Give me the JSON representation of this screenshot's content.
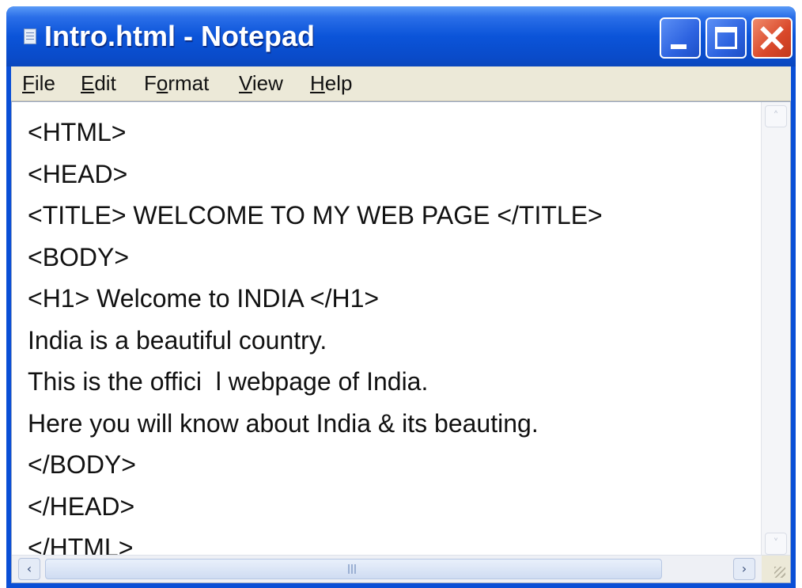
{
  "window": {
    "title": "Intro.html - Notepad",
    "icons": {
      "app": "notepad-icon",
      "minimize": "minimize-icon",
      "maximize": "maximize-icon",
      "close": "close-icon"
    }
  },
  "menu": {
    "file": "File",
    "edit": "Edit",
    "format_prefix": "F",
    "format_u": "o",
    "format_suffix": "rmat",
    "view": "View",
    "help": "Help"
  },
  "editor": {
    "lines": [
      "<HTML>",
      "<HEAD>",
      "<TITLE> WELCOME TO MY WEB PAGE </TITLE>",
      "<BODY>",
      "<H1> Welcome to INDIA </H1>",
      "India is a beautiful country.",
      "This is the offici  l webpage of India.",
      "Here you will know about India & its beauting.",
      "</BODY>",
      "</HEAD>",
      "</HTML>"
    ]
  },
  "scrollbar": {
    "up_arrow": "˄",
    "down_arrow": "˅",
    "left_arrow": "‹",
    "right_arrow": "›"
  },
  "colors": {
    "titlebar": "#0b54d9",
    "close_button": "#d9482a",
    "menubar": "#ece9d8"
  }
}
